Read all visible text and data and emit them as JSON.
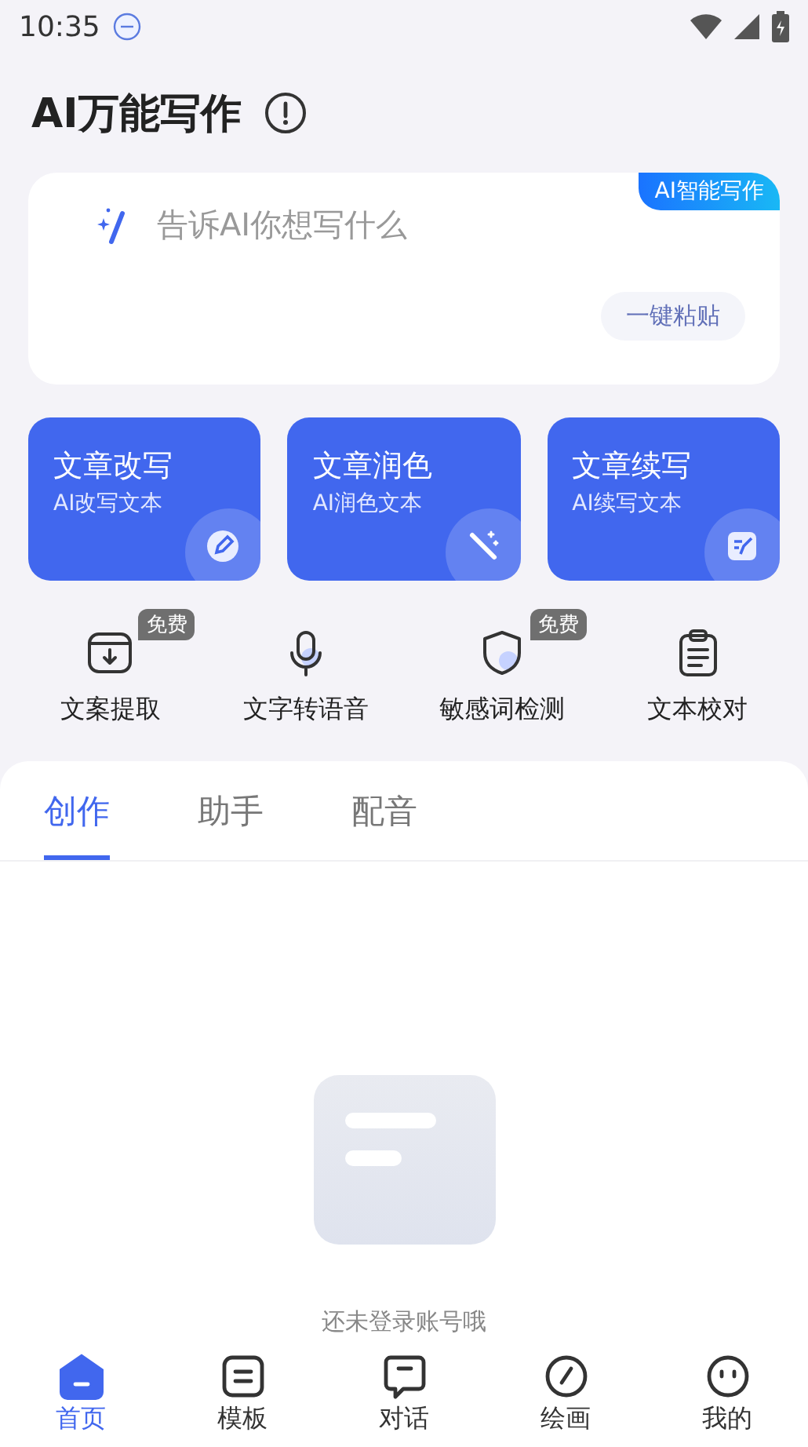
{
  "status_bar": {
    "time": "10:35"
  },
  "header": {
    "title": "AI万能写作"
  },
  "prompt_card": {
    "badge": "AI智能写作",
    "placeholder": "告诉AI你想写什么",
    "paste_button": "一键粘贴"
  },
  "feature_cards": [
    {
      "kind": "rewrite",
      "title": "文章改写",
      "subtitle": "AI改写文本"
    },
    {
      "kind": "polish",
      "title": "文章润色",
      "subtitle": "AI润色文本"
    },
    {
      "kind": "continue",
      "title": "文章续写",
      "subtitle": "AI续写文本"
    }
  ],
  "tools": [
    {
      "kind": "extract",
      "label": "文案提取",
      "badge": "免费"
    },
    {
      "kind": "voice",
      "label": "文字转语音"
    },
    {
      "kind": "shield",
      "label": "敏感词检测",
      "badge": "免费"
    },
    {
      "kind": "proofread",
      "label": "文本校对"
    }
  ],
  "tabs": [
    {
      "label": "创作",
      "selected": true
    },
    {
      "label": "助手",
      "selected": false
    },
    {
      "label": "配音",
      "selected": false
    }
  ],
  "empty_state": {
    "message": "还未登录账号哦"
  },
  "bottom_nav": [
    {
      "kind": "home",
      "label": "首页",
      "selected": true
    },
    {
      "kind": "template",
      "label": "模板",
      "selected": false
    },
    {
      "kind": "chat",
      "label": "对话",
      "selected": false
    },
    {
      "kind": "draw",
      "label": "绘画",
      "selected": false
    },
    {
      "kind": "me",
      "label": "我的",
      "selected": false
    }
  ]
}
